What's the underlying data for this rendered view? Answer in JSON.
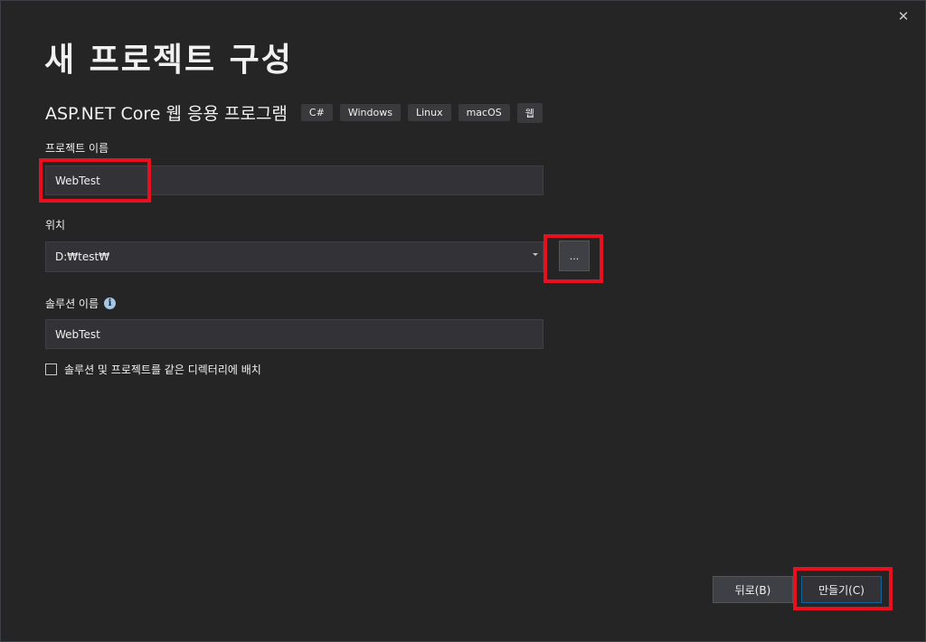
{
  "window": {
    "close_icon": "close-icon",
    "close_glyph": "✕"
  },
  "header": {
    "title": "새 프로젝트 구성",
    "subtitle": "ASP.NET Core 웹 응용 프로그램",
    "tags": [
      "C#",
      "Windows",
      "Linux",
      "macOS",
      "웹"
    ]
  },
  "form": {
    "project_name": {
      "label": "프로젝트 이름",
      "value": "WebTest"
    },
    "location": {
      "label": "위치",
      "value": "D:₩test₩",
      "browse_label": "..."
    },
    "solution_name": {
      "label": "솔루션 이름",
      "info_icon": "info-icon",
      "info_glyph": "i",
      "value": "WebTest"
    },
    "same_directory": {
      "label": "솔루션 및 프로젝트를 같은 디렉터리에 배치",
      "checked": false
    }
  },
  "footer": {
    "back_label": "뒤로(B)",
    "create_label": "만들기(C)"
  },
  "colors": {
    "background": "#252526",
    "input_background": "#333337",
    "highlight": "#e8101e",
    "accent": "#0e639c"
  }
}
